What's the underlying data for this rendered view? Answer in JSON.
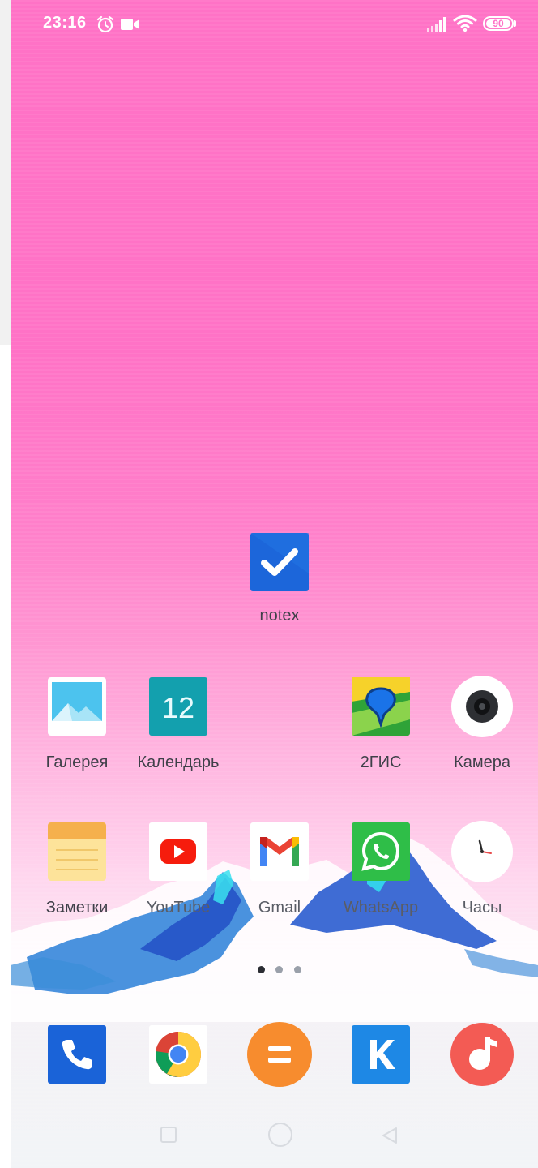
{
  "status_bar": {
    "time": "23:16",
    "battery_level": "90",
    "icons": [
      "alarm-icon",
      "video-camera-icon",
      "signal-icon",
      "wifi-icon",
      "battery-icon"
    ]
  },
  "home": {
    "folder_app": {
      "label": "notex",
      "icon": "checkmark-icon",
      "color": "#1a62d6"
    },
    "rows": [
      [
        {
          "label": "Галерея",
          "icon": "gallery-icon"
        },
        {
          "label": "Календарь",
          "icon": "calendar-icon",
          "value": "12"
        },
        {
          "label": "2ГИС",
          "icon": "2gis-icon"
        },
        {
          "label": "Камера",
          "icon": "camera-icon"
        }
      ],
      [
        {
          "label": "Заметки",
          "icon": "notes-icon"
        },
        {
          "label": "YouTube",
          "icon": "youtube-icon"
        },
        {
          "label": "Gmail",
          "icon": "gmail-icon"
        },
        {
          "label": "WhatsApp",
          "icon": "whatsapp-icon"
        },
        {
          "label": "Часы",
          "icon": "clock-icon"
        }
      ]
    ],
    "page_indicator": {
      "current": 1,
      "total": 3
    }
  },
  "dock": [
    {
      "icon": "phone-icon",
      "color": "#1a63d8"
    },
    {
      "icon": "chrome-icon"
    },
    {
      "icon": "calculator-icon",
      "color": "#f78c2e"
    },
    {
      "icon": "kate-mobile-icon",
      "color": "#1e88e5"
    },
    {
      "icon": "music-icon",
      "color": "#f35b54"
    }
  ],
  "navigation": {
    "icons": [
      "recents-square-icon",
      "home-circle-icon",
      "back-triangle-icon"
    ]
  }
}
